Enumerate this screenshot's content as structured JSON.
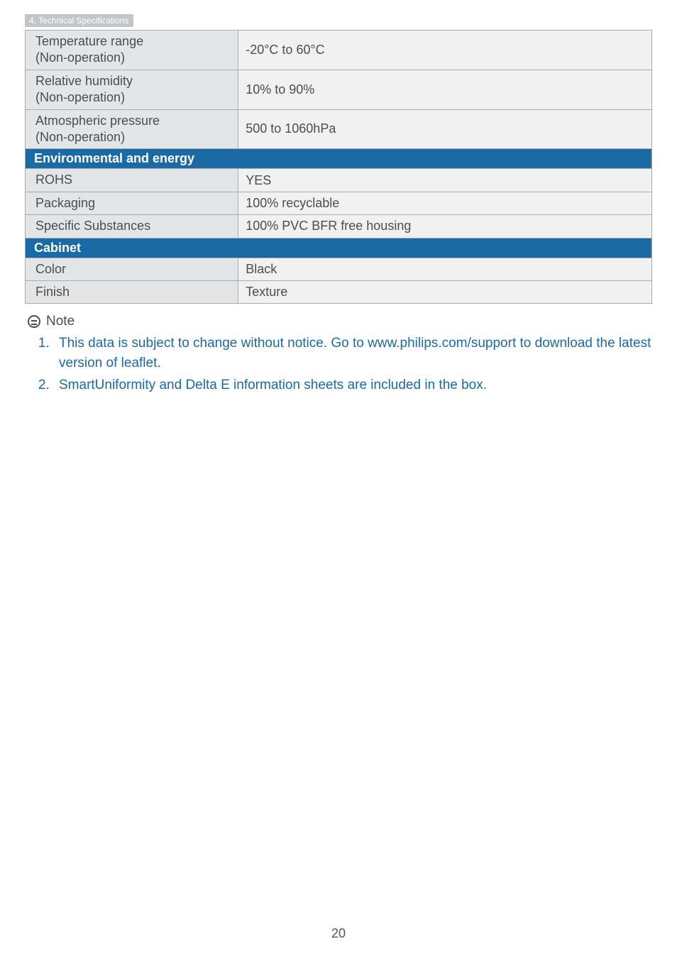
{
  "header": "4. Technical Specifications",
  "specs": {
    "temp": {
      "label1": "Temperature range",
      "label2": "(Non-operation)",
      "value": "-20°C to 60°C"
    },
    "humidity": {
      "label1": "Relative humidity",
      "label2": "(Non-operation)",
      "value": "10% to 90%"
    },
    "pressure": {
      "label1": "Atmospheric pressure",
      "label2": " (Non-operation)",
      "value": "500 to 1060hPa"
    }
  },
  "section_env": "Environmental and energy",
  "env": {
    "rohs": {
      "label": "ROHS",
      "value": "YES"
    },
    "packaging": {
      "label": "Packaging",
      "value": "100% recyclable"
    },
    "substances": {
      "label": "Specific Substances",
      "value": "100% PVC BFR free housing"
    }
  },
  "section_cabinet": "Cabinet",
  "cabinet": {
    "color": {
      "label": "Color",
      "value": "Black"
    },
    "finish": {
      "label": "Finish",
      "value": "Texture"
    }
  },
  "note": {
    "title": "Note",
    "items": [
      "This data is subject to change without notice. Go to www.philips.com/support to download the latest version of leaflet.",
      "SmartUniformity and Delta E information sheets are included in the box."
    ]
  },
  "page_number": "20"
}
